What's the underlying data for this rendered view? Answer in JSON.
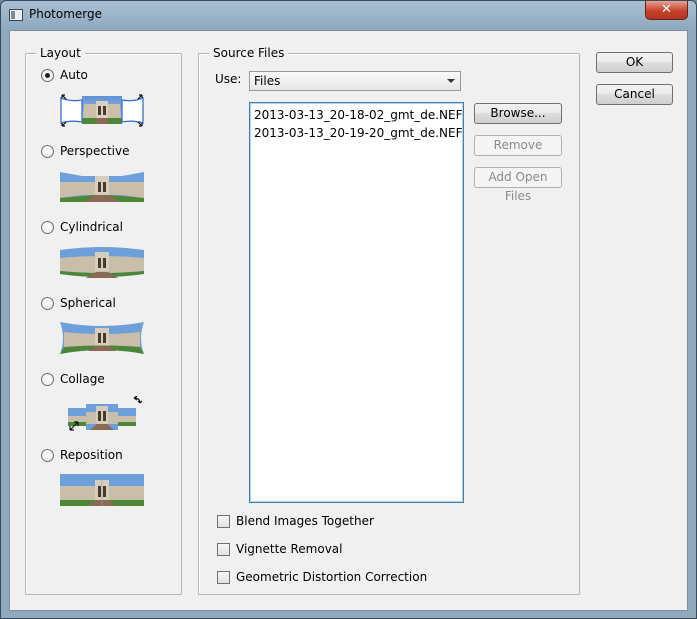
{
  "window": {
    "title": "Photomerge",
    "close_glyph": "✕"
  },
  "layout": {
    "label": "Layout",
    "options": [
      {
        "label": "Auto",
        "checked": true
      },
      {
        "label": "Perspective",
        "checked": false
      },
      {
        "label": "Cylindrical",
        "checked": false
      },
      {
        "label": "Spherical",
        "checked": false
      },
      {
        "label": "Collage",
        "checked": false
      },
      {
        "label": "Reposition",
        "checked": false
      }
    ]
  },
  "source": {
    "label": "Source Files",
    "use_label": "Use:",
    "use_value": "Files",
    "files": [
      "2013-03-13_20-18-02_gmt_de.NEF",
      "2013-03-13_20-19-20_gmt_de.NEF"
    ],
    "browse_label": "Browse...",
    "remove_label": "Remove",
    "add_open_label": "Add Open Files",
    "checkboxes": [
      {
        "label": "Blend Images Together",
        "checked": false
      },
      {
        "label": "Vignette Removal",
        "checked": false
      },
      {
        "label": "Geometric Distortion Correction",
        "checked": false
      }
    ]
  },
  "buttons": {
    "ok": "OK",
    "cancel": "Cancel"
  },
  "colors": {
    "sky": "#6f9fd8",
    "facade": "#c9c1b1",
    "path": "#8a6a54",
    "grass": "#3f7a2e",
    "frame": "#3a6fd0"
  }
}
